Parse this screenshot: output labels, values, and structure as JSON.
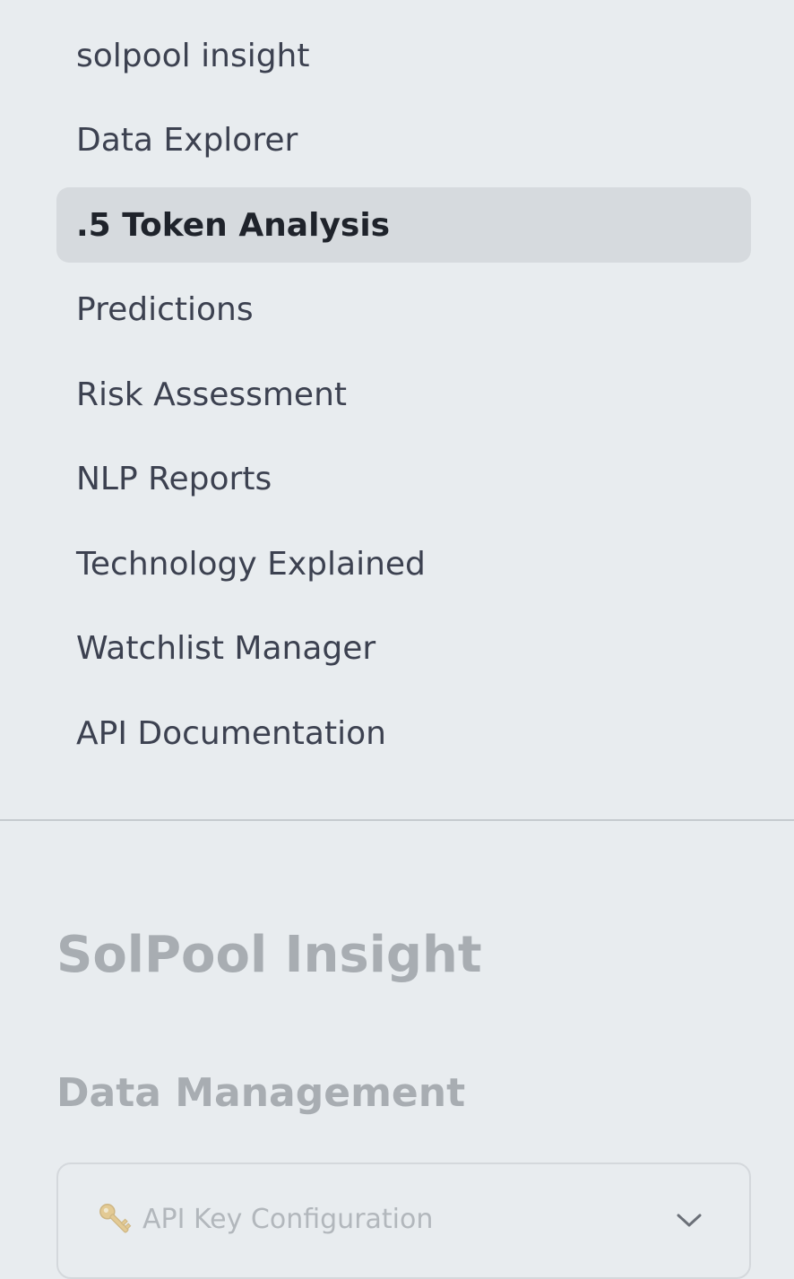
{
  "nav": {
    "items": [
      {
        "label": "solpool insight",
        "active": false
      },
      {
        "label": "Data Explorer",
        "active": false
      },
      {
        "label": ".5 Token Analysis",
        "active": true
      },
      {
        "label": "Predictions",
        "active": false
      },
      {
        "label": "Risk Assessment",
        "active": false
      },
      {
        "label": "NLP Reports",
        "active": false
      },
      {
        "label": "Technology Explained",
        "active": false
      },
      {
        "label": "Watchlist Manager",
        "active": false
      },
      {
        "label": "API Documentation",
        "active": false
      }
    ]
  },
  "sidebar": {
    "app_title": "SolPool Insight",
    "section_title": "Data Management",
    "api_key_expander": {
      "icon": "key-icon",
      "label": "API Key Configuration",
      "chevron": "chevron-down-icon"
    }
  },
  "colors": {
    "background": "#e8ecef",
    "active_item_bg": "#d6dade",
    "nav_text": "#3c4150",
    "muted_heading": "#a8adb2",
    "key_icon": "#e0b04a"
  }
}
